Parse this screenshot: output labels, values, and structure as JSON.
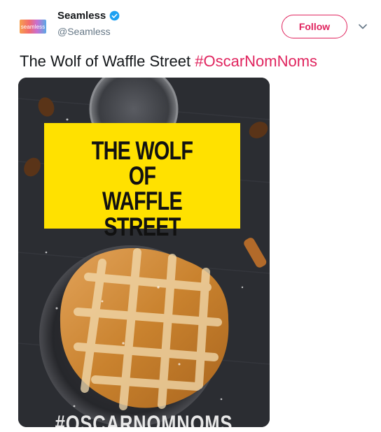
{
  "account": {
    "avatar_text": "seamless",
    "name": "Seamless",
    "handle": "@Seamless",
    "verified": true
  },
  "actions": {
    "follow_label": "Follow"
  },
  "tweet": {
    "text": "The Wolf of Waffle Street ",
    "hashtag": "#OscarNomNoms"
  },
  "image": {
    "poster_lines": [
      "THE WOLF",
      "OF",
      "WAFFLE STREET"
    ],
    "bottom_tag": "#OSCARNOMNOMS"
  },
  "colors": {
    "accent": "#e0245e",
    "verified_blue": "#1da1f2",
    "poster_yellow": "#ffe100"
  },
  "icons": {
    "verified": "verified-badge-icon",
    "caret": "chevron-down-icon"
  }
}
